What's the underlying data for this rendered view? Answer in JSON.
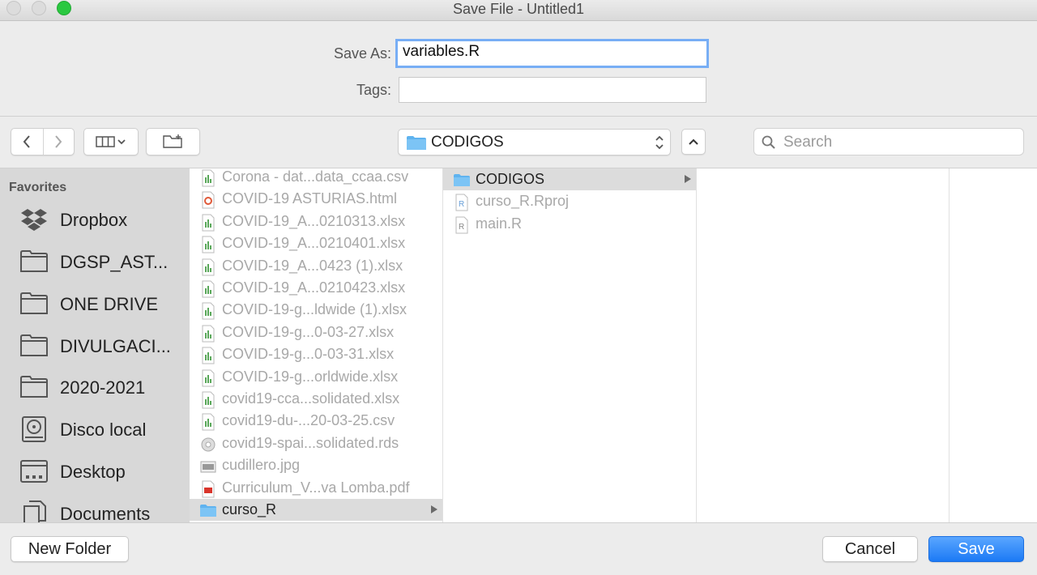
{
  "window": {
    "title": "Save File - Untitled1"
  },
  "form": {
    "save_as_label": "Save As:",
    "save_as_value": "variables.R",
    "tags_label": "Tags:",
    "tags_value": ""
  },
  "toolbar": {
    "path_label": "CODIGOS",
    "search_placeholder": "Search"
  },
  "sidebar": {
    "heading": "Favorites",
    "items": [
      {
        "label": "Dropbox",
        "icon": "dropbox-icon"
      },
      {
        "label": "DGSP_AST...",
        "icon": "folder-icon"
      },
      {
        "label": "ONE DRIVE",
        "icon": "folder-icon"
      },
      {
        "label": "DIVULGACI...",
        "icon": "folder-icon"
      },
      {
        "label": "2020-2021",
        "icon": "folder-icon"
      },
      {
        "label": "Disco local",
        "icon": "hard-disk-icon"
      },
      {
        "label": "Desktop",
        "icon": "desktop-icon"
      },
      {
        "label": "Documents",
        "icon": "documents-icon"
      }
    ]
  },
  "columns": {
    "col1": [
      {
        "name": "Corona - dat...data_ccaa.csv",
        "icon": "spreadsheet-file-icon"
      },
      {
        "name": "COVID-19 ASTURIAS.html",
        "icon": "html-file-icon"
      },
      {
        "name": "COVID-19_A...0210313.xlsx",
        "icon": "spreadsheet-file-icon"
      },
      {
        "name": "COVID-19_A...0210401.xlsx",
        "icon": "spreadsheet-file-icon"
      },
      {
        "name": "COVID-19_A...0423 (1).xlsx",
        "icon": "spreadsheet-file-icon"
      },
      {
        "name": "COVID-19_A...0210423.xlsx",
        "icon": "spreadsheet-file-icon"
      },
      {
        "name": "COVID-19-g...ldwide (1).xlsx",
        "icon": "spreadsheet-file-icon"
      },
      {
        "name": "COVID-19-g...0-03-27.xlsx",
        "icon": "spreadsheet-file-icon"
      },
      {
        "name": "COVID-19-g...0-03-31.xlsx",
        "icon": "spreadsheet-file-icon"
      },
      {
        "name": "COVID-19-g...orldwide.xlsx",
        "icon": "spreadsheet-file-icon"
      },
      {
        "name": "covid19-cca...solidated.xlsx",
        "icon": "spreadsheet-file-icon"
      },
      {
        "name": "covid19-du-...20-03-25.csv",
        "icon": "spreadsheet-file-icon"
      },
      {
        "name": "covid19-spai...solidated.rds",
        "icon": "rds-file-icon"
      },
      {
        "name": "cudillero.jpg",
        "icon": "image-file-icon"
      },
      {
        "name": "Curriculum_V...va Lomba.pdf",
        "icon": "pdf-file-icon"
      },
      {
        "name": "curso_R",
        "icon": "folder-icon",
        "selected": true
      }
    ],
    "col2": [
      {
        "name": "CODIGOS",
        "icon": "folder-icon",
        "selected": true
      },
      {
        "name": "curso_R.Rproj",
        "icon": "rproj-file-icon"
      },
      {
        "name": "main.R",
        "icon": "r-script-file-icon"
      }
    ]
  },
  "buttons": {
    "new_folder": "New Folder",
    "cancel": "Cancel",
    "save": "Save"
  },
  "colors": {
    "accent": "#1c7af5",
    "focus_ring": "#78aef5",
    "folder": "#5fb3ef",
    "traffic_green": "#2ac840"
  }
}
